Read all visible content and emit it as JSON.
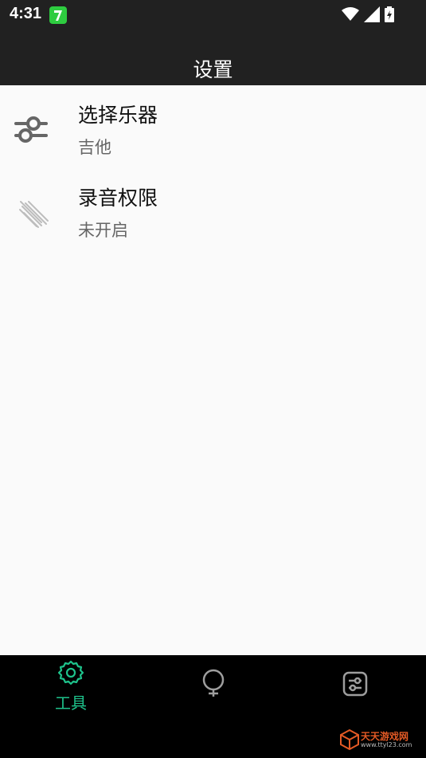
{
  "status": {
    "time": "4:31"
  },
  "header": {
    "title": "设置"
  },
  "settings": [
    {
      "title": "选择乐器",
      "subtitle": "吉他",
      "icon": "sliders-icon"
    },
    {
      "title": "录音权限",
      "subtitle": "未开启",
      "icon": "stripes-icon"
    }
  ],
  "bottom_nav": {
    "items": [
      {
        "label": "工具",
        "icon": "gear-icon",
        "active": true
      },
      {
        "label": "",
        "icon": "bulb-icon",
        "active": false
      },
      {
        "label": "",
        "icon": "toggle-settings-icon",
        "active": false
      }
    ]
  },
  "watermark": {
    "text": "天天游戏网",
    "url": "www.ttyl23.com"
  },
  "colors": {
    "bar_bg": "#212121",
    "nav_bg": "#000000",
    "accent": "#1ec28b",
    "content_bg": "#fafafa"
  }
}
